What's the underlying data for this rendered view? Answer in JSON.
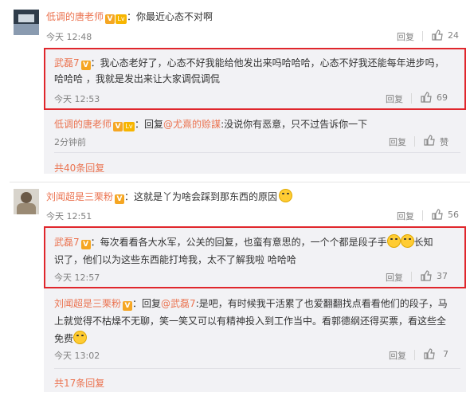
{
  "c1": {
    "user": "低调的唐老师",
    "text": "你最近心态不对啊",
    "time": "今天 12:48",
    "reply_label": "回复",
    "likes": "24"
  },
  "c1_r1": {
    "user": "武磊7",
    "line1": "我心态老好了，心态不好我能给他发出来吗哈哈哈，心态不好我还能每年进步吗，",
    "line2": "哈哈哈 ，我就是发出来让大家调侃调侃",
    "time": "今天 12:53",
    "reply_label": "回复",
    "likes": "69"
  },
  "c1_r2": {
    "user": "低调的唐老师",
    "reply_prefix": "回复",
    "mention": "@尤熹的赊謀",
    "text": ":没说你有恶意，只不过告诉你一下",
    "time": "2分钟前",
    "reply_label": "回复",
    "likes": "赞"
  },
  "c1_more": "共40条回复",
  "c2": {
    "user": "刘闻超是三栗粉",
    "text": "这就是丫为啥会踩到那东西的原因",
    "time": "今天 12:51",
    "reply_label": "回复",
    "likes": "56"
  },
  "c2_r1": {
    "user": "武磊7",
    "line1a": "每次看看各大水军，公关的回复，也蛮有意思的，一个个都是段子手",
    "line1b": "长知",
    "line2": "识了，他们以为这些东西能打垮我，太不了解我啦 哈哈哈",
    "time": "今天 12:57",
    "reply_label": "回复",
    "likes": "37"
  },
  "c2_r2": {
    "user": "刘闻超是三栗粉",
    "reply_prefix": "回复",
    "mention": "@武磊7",
    "line1": ":是吧，有时候我干活累了也爱翻翻找点看看他们的段子，马",
    "line2": "上就觉得不枯燥不无聊，笑一笑又可以有精神投入到工作当中。看郭德纲还得买票，看这些全",
    "line3": "免费",
    "time": "今天 13:02",
    "reply_label": "回复",
    "likes": "7"
  },
  "c2_more": "共17条回复",
  "colors": {
    "name": "#eb7350",
    "highlight_border": "#e0262c",
    "reply_bg": "#f2f2f5"
  }
}
